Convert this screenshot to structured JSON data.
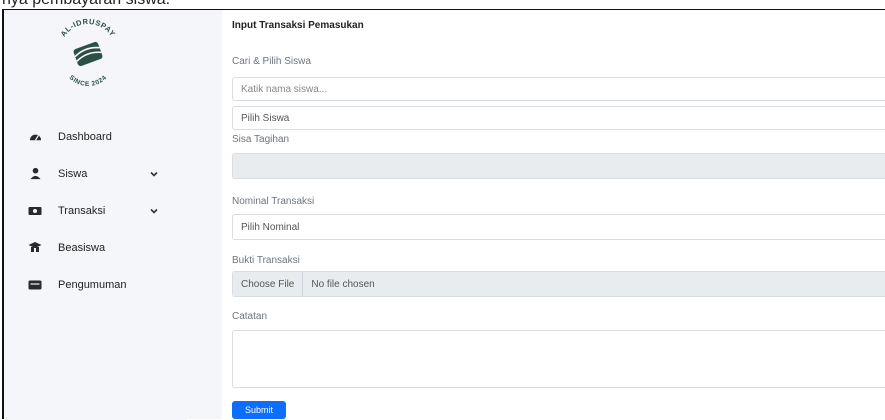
{
  "page_header": "nya pembayaran siswa.",
  "brand": {
    "logo_top": "AL-IDRUSPAY",
    "logo_bottom": "SINCE 2024"
  },
  "sidebar": {
    "items": [
      {
        "label": "Dashboard",
        "icon": "dashboard-icon",
        "has_chevron": false
      },
      {
        "label": "Siswa",
        "icon": "user-icon",
        "has_chevron": true
      },
      {
        "label": "Transaksi",
        "icon": "money-icon",
        "has_chevron": true
      },
      {
        "label": "Beasiswa",
        "icon": "graduation-icon",
        "has_chevron": false
      },
      {
        "label": "Pengumuman",
        "icon": "announcement-icon",
        "has_chevron": false
      }
    ]
  },
  "form": {
    "title": "Input Transaksi Pemasukan",
    "search_label": "Cari & Pilih Siswa",
    "search_placeholder": "Katik nama siswa...",
    "student_select_value": "Pilih Siswa",
    "remaining_bill_label": "Sisa Tagihan",
    "remaining_bill_value": "",
    "amount_label": "Nominal Transaksi",
    "amount_select_value": "Pilih Nominal",
    "proof_label": "Bukti Transaksi",
    "file_button": "Choose File",
    "file_status": "No file chosen",
    "notes_label": "Catatan",
    "notes_value": "",
    "submit_label": "Submit"
  },
  "colors": {
    "logo_green": "#2c4f46",
    "sidebar_bg": "#f4f6f9",
    "primary_button": "#0d6efd"
  }
}
